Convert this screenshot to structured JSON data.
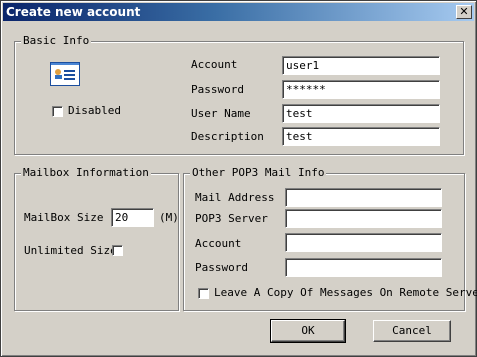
{
  "window": {
    "title": "Create new account",
    "close_glyph": "✕"
  },
  "basic_info": {
    "legend": "Basic Info",
    "icon": "account-card-icon",
    "disabled_label": "Disabled",
    "account_label": "Account",
    "account_value": "user1",
    "password_label": "Password",
    "password_value": "******",
    "username_label": "User Name",
    "username_value": "test",
    "description_label": "Description",
    "description_value": "test"
  },
  "mailbox": {
    "legend": "Mailbox Information",
    "size_label": "MailBox Size",
    "size_value": "20",
    "size_unit": "(M)",
    "unlimited_label": "Unlimited Size"
  },
  "pop3": {
    "legend": "Other POP3 Mail Info",
    "mail_address_label": "Mail Address",
    "mail_address_value": "",
    "server_label": "POP3 Server",
    "server_value": "",
    "account_label": "Account",
    "account_value": "",
    "password_label": "Password",
    "password_value": "",
    "leave_copy_label": "Leave A Copy Of Messages On Remote Server"
  },
  "buttons": {
    "ok": "OK",
    "cancel": "Cancel"
  }
}
